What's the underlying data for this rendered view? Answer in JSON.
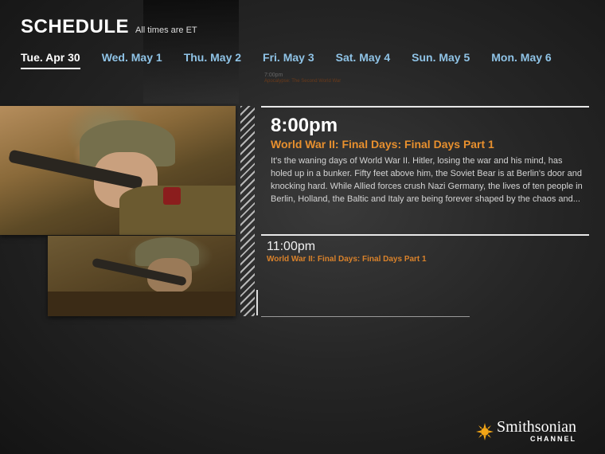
{
  "header": {
    "title": "SCHEDULE",
    "subtitle": "All times are ET"
  },
  "tabs": [
    {
      "label": "Tue. Apr 30",
      "active": true
    },
    {
      "label": "Wed. May 1",
      "active": false
    },
    {
      "label": "Thu. May 2",
      "active": false
    },
    {
      "label": "Fri. May 3",
      "active": false
    },
    {
      "label": "Sat. May 4",
      "active": false
    },
    {
      "label": "Sun. May 5",
      "active": false
    },
    {
      "label": "Mon. May 6",
      "active": false
    }
  ],
  "previous": {
    "time": "7:00pm",
    "title": "Apocalypse: The Second World War"
  },
  "featured": {
    "time": "8:00pm",
    "title": "World War II: Final Days: Final Days Part 1",
    "description": "It's the waning days of World War II. Hitler, losing the war and his mind, has holed up in a bunker. Fifty feet above him, the Soviet Bear is at Berlin's door and knocking hard. While Allied forces crush Nazi Germany, the lives of ten people in Berlin, Holland, the Baltic and Italy are being forever shaped by the chaos and..."
  },
  "next": {
    "time": "11:00pm",
    "title": "World War II: Final Days: Final Days Part 1"
  },
  "logo": {
    "name": "Smithsonian",
    "sub": "CHANNEL"
  },
  "colors": {
    "accent": "#e8902e",
    "tab": "#8fc3e6",
    "text": "#ffffff"
  }
}
